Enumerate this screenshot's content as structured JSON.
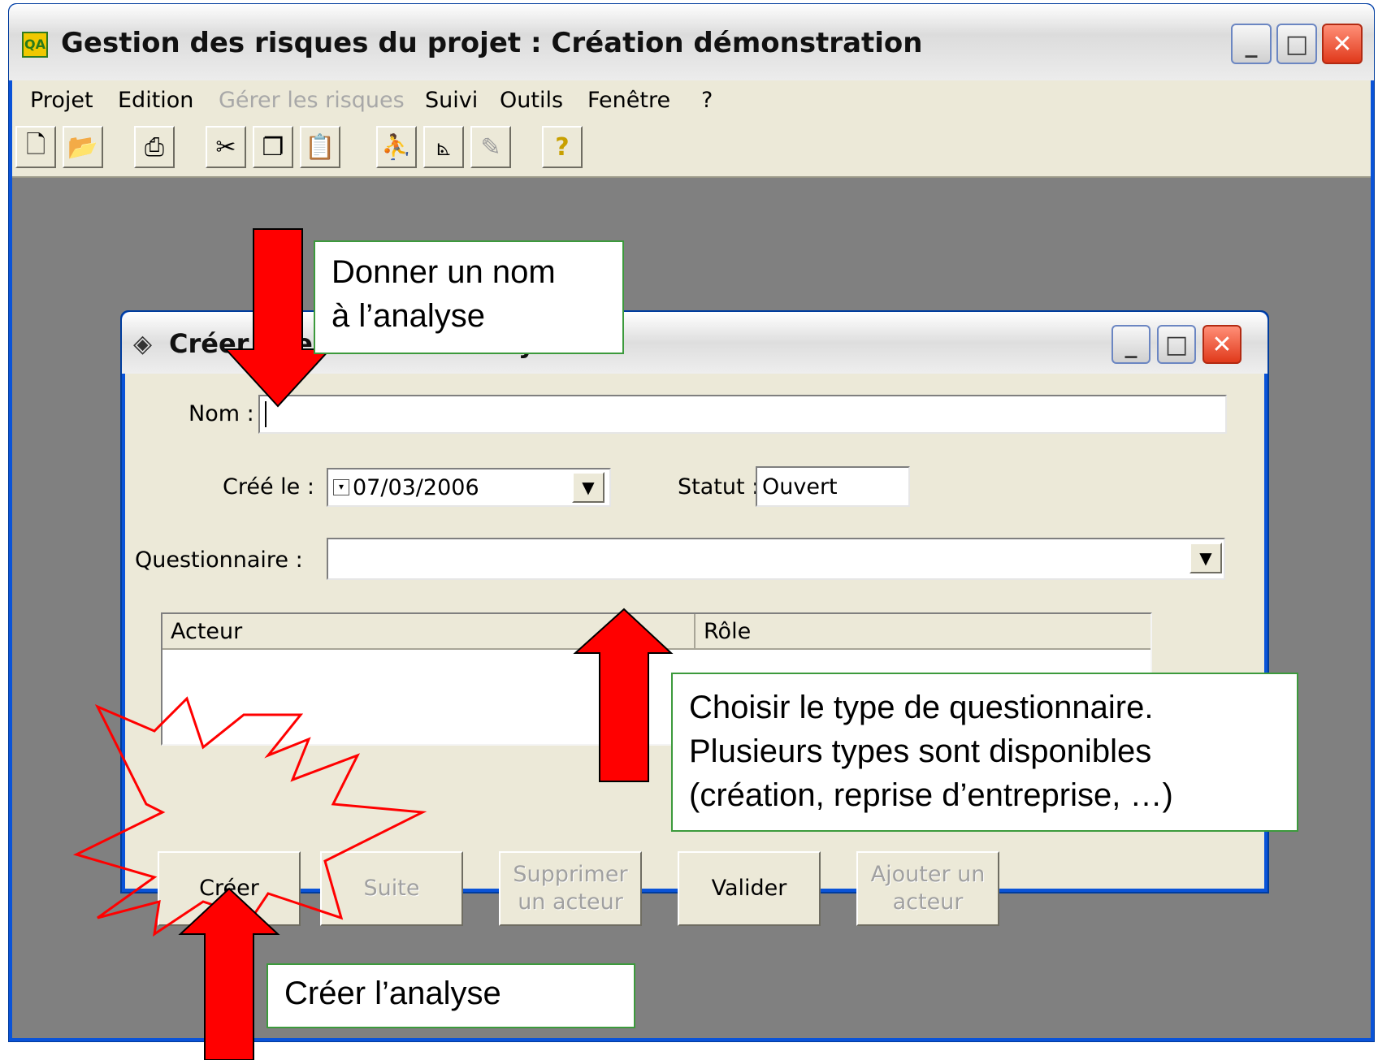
{
  "window": {
    "title": "Gestion des risques du projet : Création démonstration",
    "app_icon_text": "QA",
    "buttons": {
      "minimize": "_",
      "maximize": "□",
      "close": "✕"
    }
  },
  "menu": {
    "items": [
      "Projet",
      "Edition",
      "Gérer les risques",
      "Suivi",
      "Outils",
      "Fenêtre",
      "?"
    ]
  },
  "toolbar": {
    "icons": [
      "new-file-icon",
      "open-folder-icon",
      "print-icon",
      "cut-icon",
      "copy-icon",
      "paste-icon",
      "find-icon",
      "chart-icon",
      "edit-icon",
      "help-icon"
    ]
  },
  "dialog": {
    "title": "Créer une nouvelle analyse",
    "nom_label": "Nom :",
    "nom_value": "",
    "cree_label": "Créé le :",
    "cree_value": "07/03/2006",
    "statut_label": "Statut :",
    "statut_value": "Ouvert",
    "questionnaire_label": "Questionnaire :",
    "questionnaire_value": "",
    "columns": [
      "Acteur",
      "Rôle"
    ],
    "buttons": {
      "creer": "Créer",
      "suite": "Suite",
      "supprimer_line1": "Supprimer",
      "supprimer_line2": "un acteur",
      "valider": "Valider",
      "ajouter_line1": "Ajouter un",
      "ajouter_line2": "acteur"
    }
  },
  "annotations": {
    "nom_line1": "Donner un nom",
    "nom_line2": "à l’analyse",
    "quest_line1": "Choisir le type de questionnaire.",
    "quest_line2": "Plusieurs types sont disponibles",
    "quest_line3": "(création, reprise d’entreprise, …)",
    "creer": "Créer l’analyse"
  },
  "colors": {
    "arrow": "#ff0000",
    "callout_border": "#3c9a3c",
    "xp_blue": "#0a53d8",
    "desktop_gray": "#808080"
  }
}
